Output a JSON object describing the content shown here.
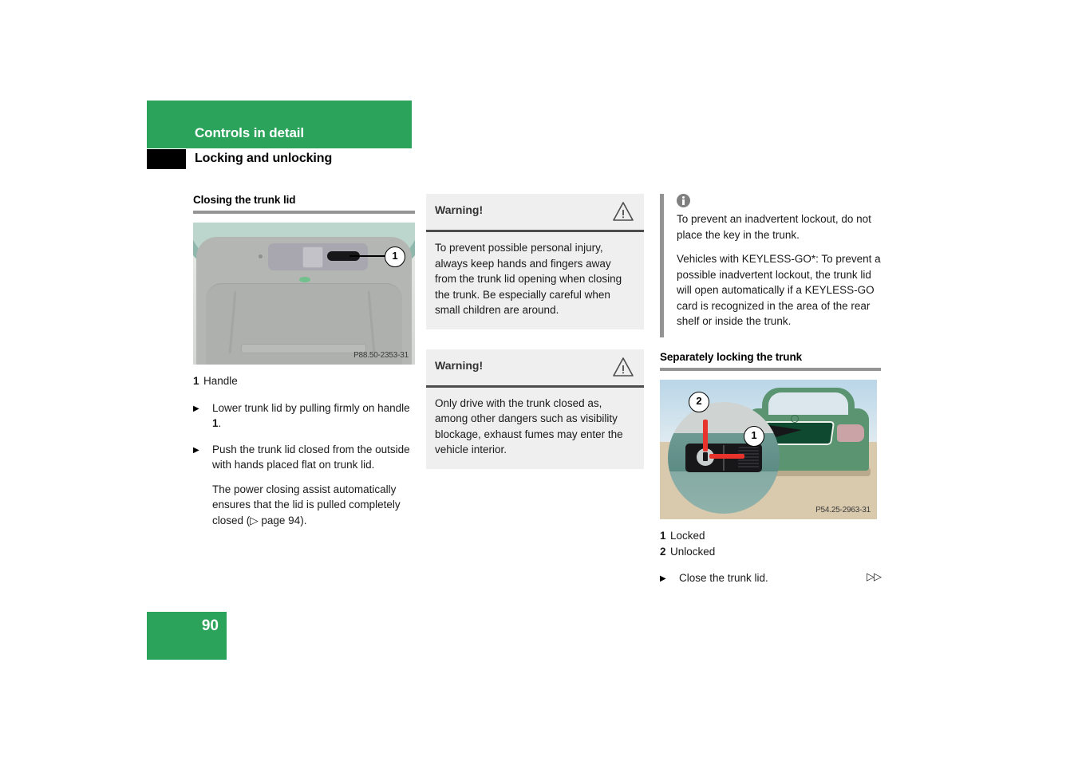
{
  "header": {
    "chapter": "Controls in detail",
    "section": "Locking and unlocking",
    "green": "#2ba35a"
  },
  "footer": {
    "page_number": "90"
  },
  "left_column": {
    "heading": "Closing the trunk lid",
    "figure": {
      "code": "P88.50-2353-31",
      "callout_1": "1"
    },
    "legend": [
      {
        "num": "1",
        "text": "Handle"
      }
    ],
    "steps": [
      {
        "marker": "▶",
        "text_before": "Lower trunk lid by pulling firmly on handle ",
        "bold": "1",
        "text_after": "."
      },
      {
        "marker": "▶",
        "text_before": "Push the trunk lid closed from the outside with hands placed flat on trunk lid.",
        "bold": "",
        "text_after": ""
      }
    ],
    "note": "The power closing assist automatically ensures that the lid is pulled completely closed (▷ page 94)."
  },
  "middle_column": {
    "warnings": [
      {
        "label": "Warning!",
        "icon": "warning-triangle-icon",
        "body": "To prevent possible personal injury, always keep hands and fingers away from the trunk lid opening when closing the trunk. Be especially careful when small children are around."
      },
      {
        "label": "Warning!",
        "icon": "warning-triangle-icon",
        "body": "Only drive with the trunk closed as, among other dangers such as visibility blockage, exhaust fumes may enter the vehicle interior."
      }
    ]
  },
  "right_column": {
    "info": {
      "icon": "info-circle-icon",
      "paragraphs": [
        "To prevent an inadvertent lockout, do not place the key in the trunk.",
        "Vehicles with KEYLESS-GO*: To prevent a possible inadvertent lockout, the trunk lid will open automatically if a KEYLESS-GO card is recognized in the area of the rear shelf or inside the trunk."
      ]
    },
    "heading": "Separately locking the trunk",
    "figure": {
      "code": "P54.25-2963-31",
      "callout_1": "1",
      "callout_2": "2"
    },
    "legend": [
      {
        "num": "1",
        "text": "Locked"
      },
      {
        "num": "2",
        "text": "Unlocked"
      }
    ],
    "step": {
      "marker": "▶",
      "text": "Close the trunk lid.",
      "continue": "▷▷"
    }
  }
}
